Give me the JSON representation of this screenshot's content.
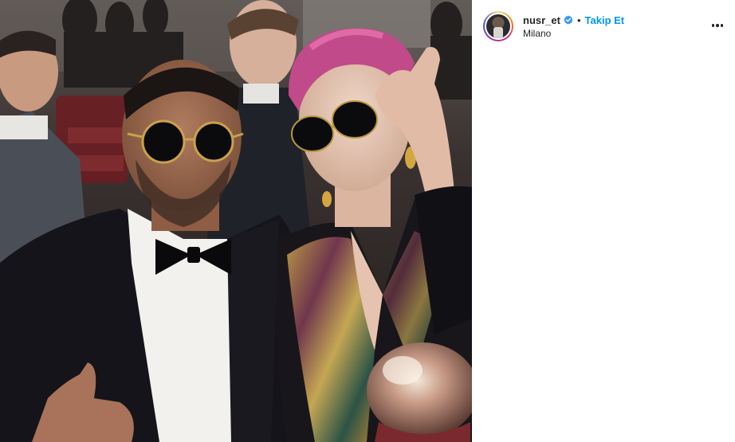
{
  "post": {
    "username": "nusr_et",
    "verified": true,
    "separator": "•",
    "follow_label": "Takip Et",
    "location": "Milano"
  },
  "colors": {
    "accent": "#0095f6",
    "text": "#262626",
    "verified_badge": "#3897f0"
  },
  "icons": {
    "verified": "verified-badge-icon",
    "more": "more-options-icon"
  }
}
